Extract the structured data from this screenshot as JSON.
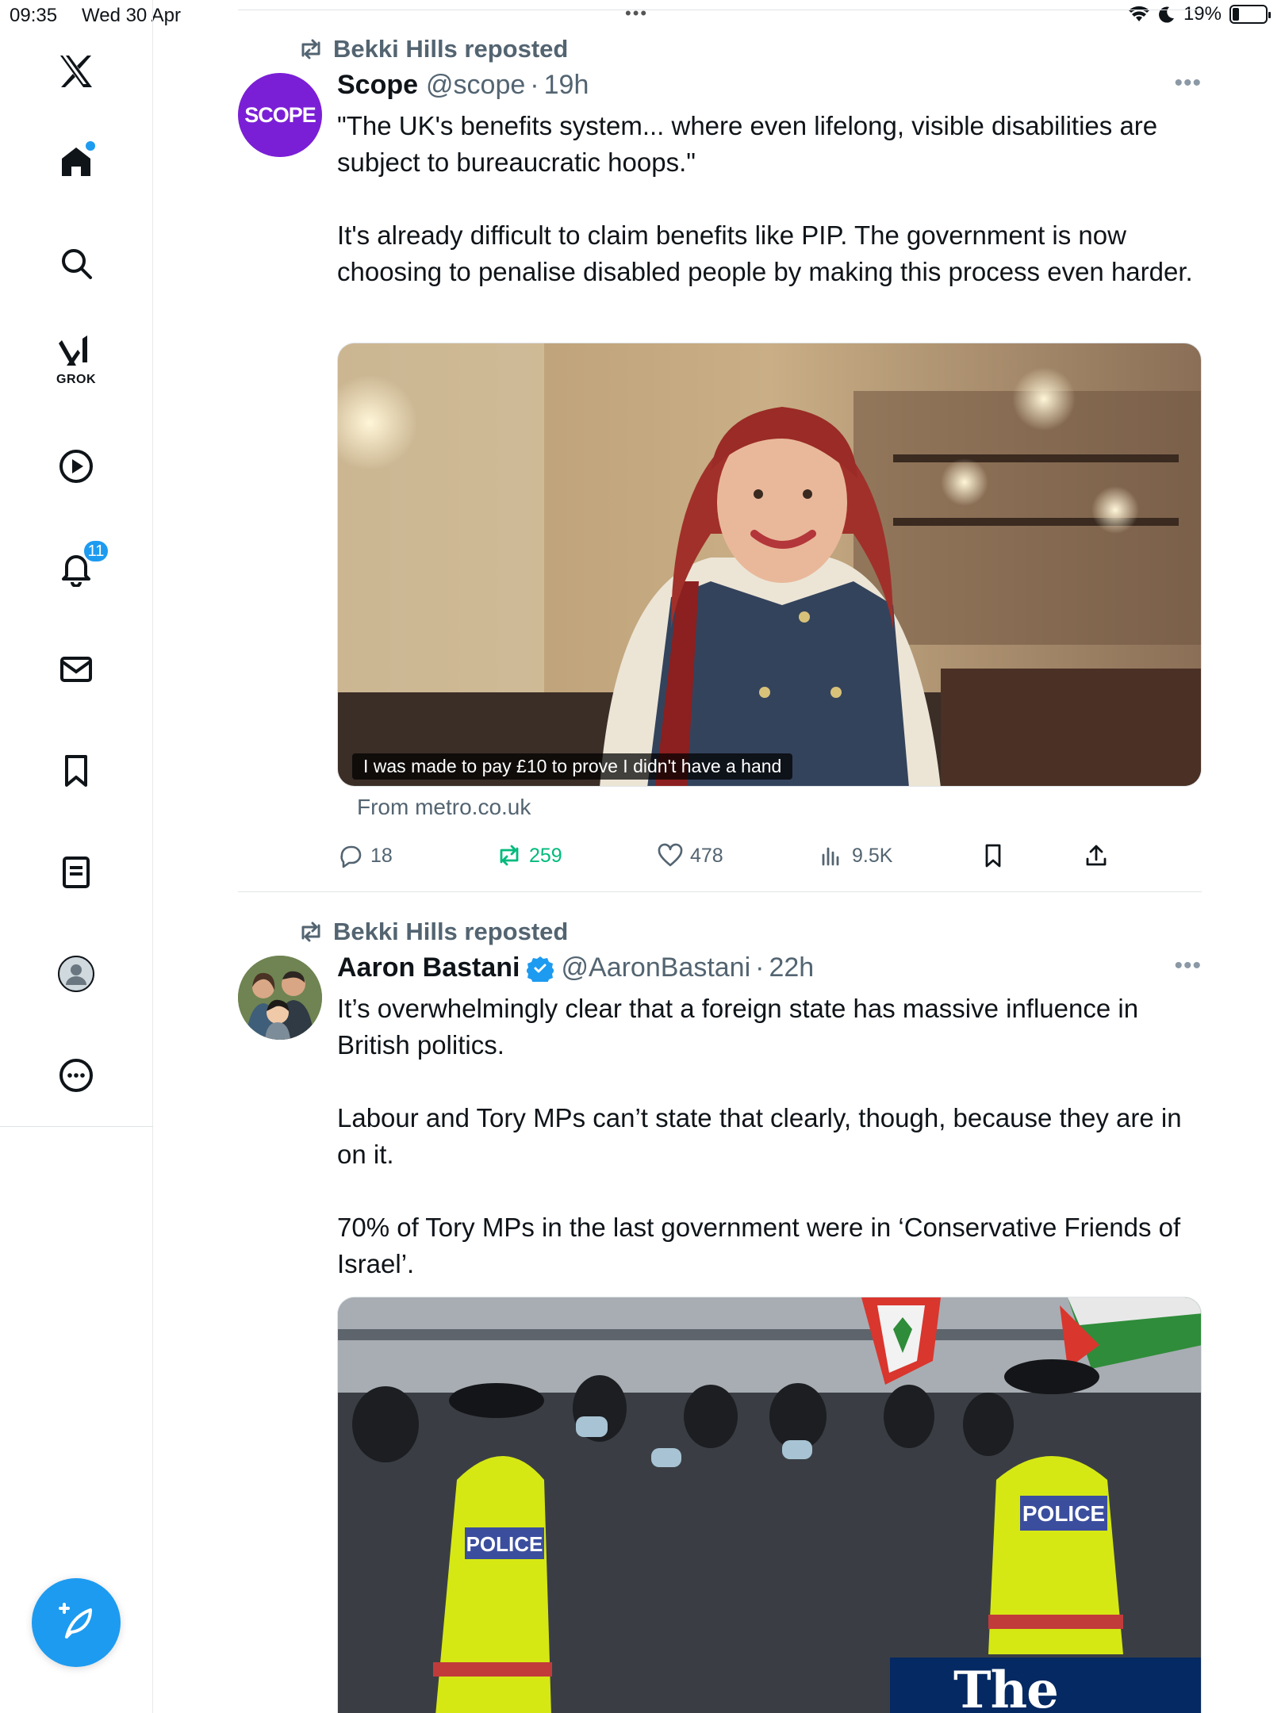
{
  "status_bar": {
    "time": "09:35",
    "date": "Wed 30 Apr",
    "battery": "19%",
    "battery_level": 0.19
  },
  "sidebar": {
    "items": [
      {
        "name": "x-logo",
        "icon": "x-logo-icon"
      },
      {
        "name": "home",
        "icon": "home-icon",
        "has_dot": true
      },
      {
        "name": "search",
        "icon": "search-icon"
      },
      {
        "name": "grok",
        "icon": "grok-icon",
        "label": "GROK"
      },
      {
        "name": "video",
        "icon": "play-circle-icon"
      },
      {
        "name": "notifications",
        "icon": "bell-icon",
        "badge": "11"
      },
      {
        "name": "messages",
        "icon": "envelope-icon"
      },
      {
        "name": "bookmarks",
        "icon": "bookmark-icon"
      },
      {
        "name": "lists",
        "icon": "list-icon"
      },
      {
        "name": "profile",
        "icon": "avatar-icon"
      },
      {
        "name": "more",
        "icon": "more-circle-icon"
      }
    ],
    "compose_icon": "feather-plus-icon"
  },
  "colors": {
    "accent": "#1d9bf0",
    "text": "#0f1419",
    "secondary": "#536471",
    "repost_green": "#00ba7c",
    "scope_purple": "#7a1fd6",
    "guardian_blue": "#052962"
  },
  "feed": [
    {
      "reposted_by": "Bekki Hills reposted",
      "author": {
        "name": "Scope",
        "handle": "@scope",
        "verified": false,
        "avatar_text": "SCOPE"
      },
      "age": "19h",
      "body": [
        "\"The UK's benefits system... where even lifelong, visible disabilities are subject to bureaucratic hoops.\"",
        "It's already difficult to claim benefits like PIP. The government is now choosing to penalise disabled people by making this process even harder."
      ],
      "media_caption": "I was made to pay £10 to prove I didn't have a hand",
      "source": "From metro.co.uk",
      "stats": {
        "replies": "18",
        "reposts": "259",
        "likes": "478",
        "views": "9.5K"
      },
      "reposted_by_me": true
    },
    {
      "reposted_by": "Bekki Hills reposted",
      "author": {
        "name": "Aaron Bastani",
        "handle": "@AaronBastani",
        "verified": true
      },
      "age": "22h",
      "body": [
        "It’s overwhelmingly clear that a foreign state has massive influence in British politics.",
        "Labour and Tory MPs can’t state that clearly, though, because they are in on it.",
        "70% of Tory MPs in the last government were in ‘Conservative Friends of Israel’."
      ],
      "media_watermark": "The Guardian",
      "media_signs": [
        "POLICE",
        "POLICE"
      ]
    }
  ]
}
